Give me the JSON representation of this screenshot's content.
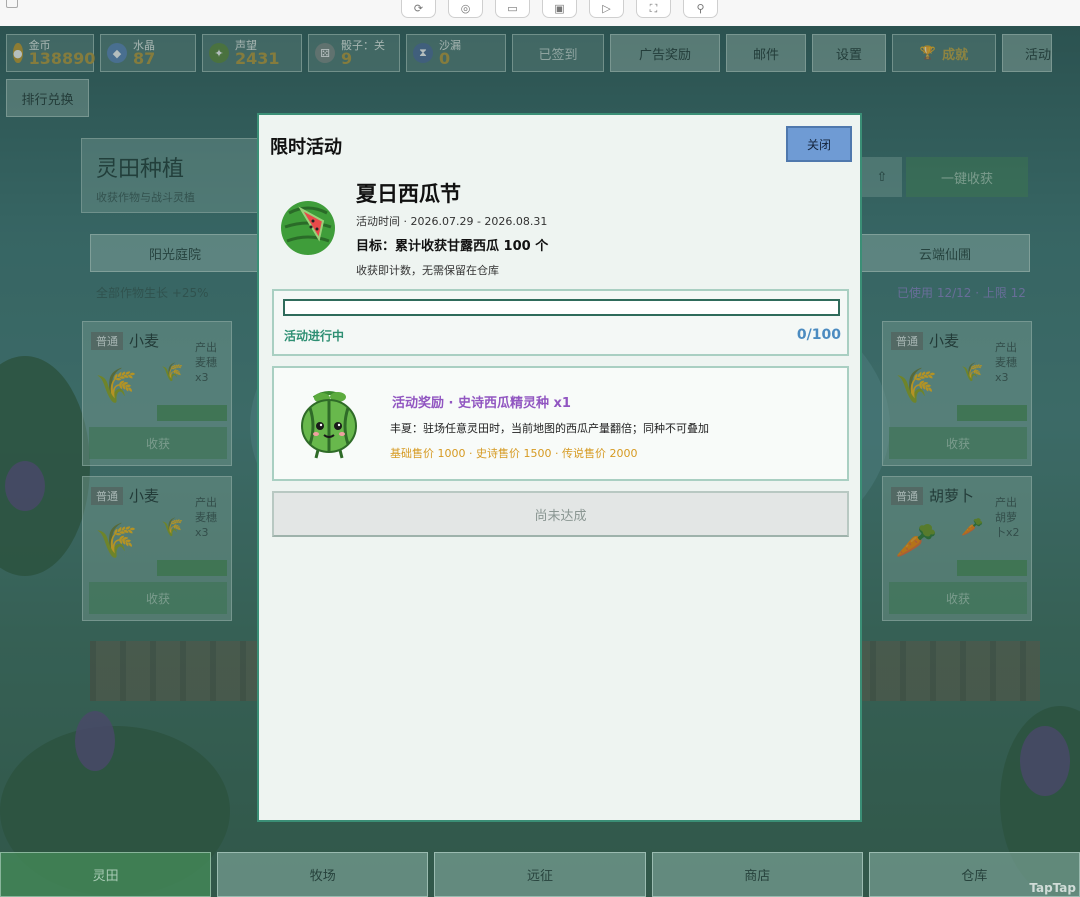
{
  "browser": {
    "tools": [
      "refresh-icon",
      "eye-off-icon",
      "device-icon",
      "screenshot-icon",
      "record-icon",
      "fullscreen-icon",
      "share-icon"
    ]
  },
  "resources": [
    {
      "label": "金币",
      "value": "138890",
      "icon": "coin-icon"
    },
    {
      "label": "水晶",
      "value": "87",
      "icon": "crystal-icon"
    },
    {
      "label": "声望",
      "value": "2431",
      "icon": "prestige-icon"
    },
    {
      "label": "骰子：关",
      "value": "9",
      "icon": "dice-icon"
    },
    {
      "label": "沙漏",
      "value": "0",
      "icon": "hourglass-icon"
    }
  ],
  "top_buttons": {
    "signed": "已签到",
    "ad_reward": "广告奖励",
    "mail": "邮件",
    "settings": "设置",
    "achievement": "成就",
    "activity": "活动",
    "rank_exchange": "排行兑换"
  },
  "farm": {
    "title": "灵田种植",
    "subtitle": "收获作物与战斗灵植",
    "harvest_all": "一键收获",
    "zone_left": "阳光庭院",
    "zone_left_note": "全部作物生长 +25%",
    "zone_right": "云端仙圃",
    "zone_right_note": "已使用 12/12 · 上限 12",
    "plots": [
      {
        "quality": "普通",
        "name": "小麦",
        "prod": "产出麦穗x3",
        "harvest": "收获"
      },
      {
        "quality": "普通",
        "name": "小麦",
        "prod": "产出麦穗x3",
        "harvest": "收获"
      },
      {
        "quality": "普通",
        "name": "小麦",
        "prod": "产出麦穗x3",
        "harvest": "收获"
      },
      {
        "quality": "普通",
        "name": "胡萝卜",
        "prod": "产出胡萝卜x2",
        "harvest": "收获"
      }
    ]
  },
  "modal": {
    "title": "限时活动",
    "close": "关闭",
    "event_name": "夏日西瓜节",
    "event_time": "活动时间 · 2026.07.29 - 2026.08.31",
    "goal": "目标：累计收获甘露西瓜 100 个",
    "note": "收获即计数，无需保留在仓库",
    "progress_label": "活动进行中",
    "progress_count": "0/100",
    "progress": 0,
    "reward_title": "活动奖励 · 史诗西瓜精灵种 x1",
    "reward_desc": "丰夏：驻场任意灵田时，当前地图的西瓜产量翻倍；同种不可叠加",
    "reward_price": "基础售价 1000 · 史诗售价 1500 · 传说售价 2000",
    "pending": "尚未达成"
  },
  "nav": [
    "灵田",
    "牧场",
    "远征",
    "商店",
    "仓库"
  ],
  "watermark": "TapTap"
}
